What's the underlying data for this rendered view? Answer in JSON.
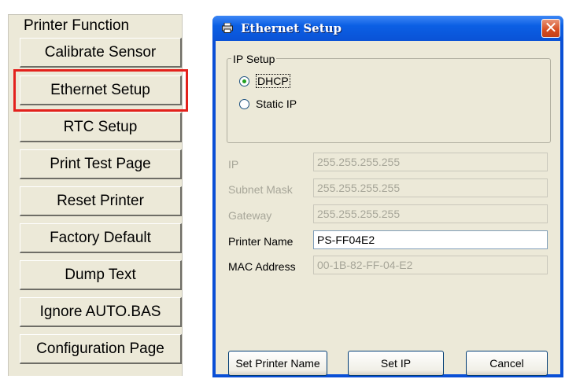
{
  "printer_function": {
    "title": "Printer Function",
    "buttons": [
      "Calibrate Sensor",
      "Ethernet Setup",
      "RTC Setup",
      "Print Test Page",
      "Reset Printer",
      "Factory Default",
      "Dump Text",
      "Ignore AUTO.BAS",
      "Configuration Page"
    ],
    "highlighted": "Ethernet Setup",
    "highlight_color": "#e3211c"
  },
  "dialog": {
    "title": "Ethernet Setup",
    "title_icon": "printer-icon",
    "close_glyph": "✕",
    "ip_setup": {
      "title": "IP Setup",
      "options": [
        "DHCP",
        "Static IP"
      ],
      "selected": "DHCP"
    },
    "fields": {
      "ip": {
        "label": "IP",
        "value": "255.255.255.255",
        "enabled": false
      },
      "subnet": {
        "label": "Subnet Mask",
        "value": "255.255.255.255",
        "enabled": false
      },
      "gateway": {
        "label": "Gateway",
        "value": "255.255.255.255",
        "enabled": false
      },
      "printer_name": {
        "label": "Printer Name",
        "value": "PS-FF04E2",
        "enabled": true
      },
      "mac": {
        "label": "MAC Address",
        "value": "00-1B-82-FF-04-E2",
        "enabled": false
      }
    },
    "buttons": {
      "set_printer_name": "Set Printer Name",
      "set_ip": "Set IP",
      "cancel": "Cancel"
    }
  },
  "colors": {
    "titlebar": "#0a52d6",
    "dialog_face": "#ece9d8",
    "close_button": "#d64d20"
  }
}
